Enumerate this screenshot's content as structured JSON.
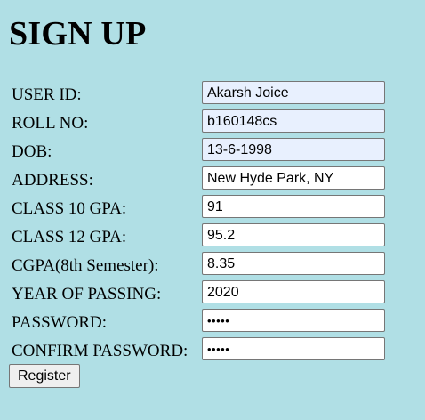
{
  "page": {
    "title": "SIGN UP"
  },
  "form": {
    "fields": [
      {
        "key": "user_id",
        "label": "USER ID:",
        "value": "Akarsh Joice",
        "autofilled": true,
        "type": "text"
      },
      {
        "key": "roll_no",
        "label": "ROLL NO:",
        "value": "b160148cs",
        "autofilled": true,
        "type": "text"
      },
      {
        "key": "dob",
        "label": "DOB:",
        "value": "13-6-1998",
        "autofilled": true,
        "type": "text"
      },
      {
        "key": "address",
        "label": "ADDRESS:",
        "value": "New Hyde Park, NY",
        "autofilled": false,
        "type": "text"
      },
      {
        "key": "class10_gpa",
        "label": "CLASS 10 GPA:",
        "value": "91",
        "autofilled": false,
        "type": "text"
      },
      {
        "key": "class12_gpa",
        "label": "CLASS 12 GPA:",
        "value": "95.2",
        "autofilled": false,
        "type": "text"
      },
      {
        "key": "cgpa",
        "label": "CGPA(8th Semester):",
        "value": "8.35",
        "autofilled": false,
        "type": "text"
      },
      {
        "key": "year_of_passing",
        "label": "YEAR OF PASSING:",
        "value": "2020",
        "autofilled": false,
        "type": "text"
      },
      {
        "key": "password",
        "label": "PASSWORD:",
        "value": "•••••",
        "autofilled": false,
        "type": "password"
      },
      {
        "key": "confirm_password",
        "label": "CONFIRM PASSWORD:",
        "value": "•••••",
        "autofilled": false,
        "type": "password"
      }
    ],
    "register_label": "Register"
  },
  "colors": {
    "page_background": "#b0dfe5",
    "autofill_background": "#e8f0fe",
    "input_border": "#767676",
    "button_background": "#efefef"
  }
}
